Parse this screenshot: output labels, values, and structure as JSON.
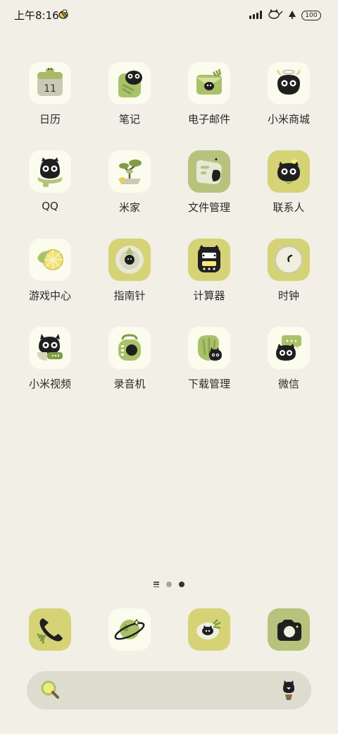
{
  "status_bar": {
    "time": "上午8:16",
    "battery": "100"
  },
  "apps": [
    {
      "label": "日历",
      "icon": "calendar-icon"
    },
    {
      "label": "笔记",
      "icon": "notes-icon"
    },
    {
      "label": "电子邮件",
      "icon": "email-icon"
    },
    {
      "label": "小米商城",
      "icon": "mi-store-icon"
    },
    {
      "label": "QQ",
      "icon": "qq-icon"
    },
    {
      "label": "米家",
      "icon": "mijia-icon"
    },
    {
      "label": "文件管理",
      "icon": "file-manager-icon"
    },
    {
      "label": "联系人",
      "icon": "contacts-icon"
    },
    {
      "label": "游戏中心",
      "icon": "game-center-icon"
    },
    {
      "label": "指南针",
      "icon": "compass-icon"
    },
    {
      "label": "计算器",
      "icon": "calculator-icon"
    },
    {
      "label": "时钟",
      "icon": "clock-icon"
    },
    {
      "label": "小米视频",
      "icon": "mi-video-icon"
    },
    {
      "label": "录音机",
      "icon": "recorder-icon"
    },
    {
      "label": "下载管理",
      "icon": "download-manager-icon"
    },
    {
      "label": "微信",
      "icon": "wechat-icon"
    }
  ],
  "calendar_day": "11",
  "page_indicator": {
    "pages": 2,
    "current": 2
  },
  "dock": [
    {
      "icon": "phone-icon"
    },
    {
      "icon": "browser-icon"
    },
    {
      "icon": "messages-icon"
    },
    {
      "icon": "camera-icon"
    }
  ],
  "colors": {
    "background": "#f1efe6",
    "cream_tile": "#fbfbee",
    "lime_tile": "#d5d376",
    "olive_tile": "#b7c27c",
    "cat_black": "#1f1f1f",
    "search_bar": "#dddccf"
  }
}
